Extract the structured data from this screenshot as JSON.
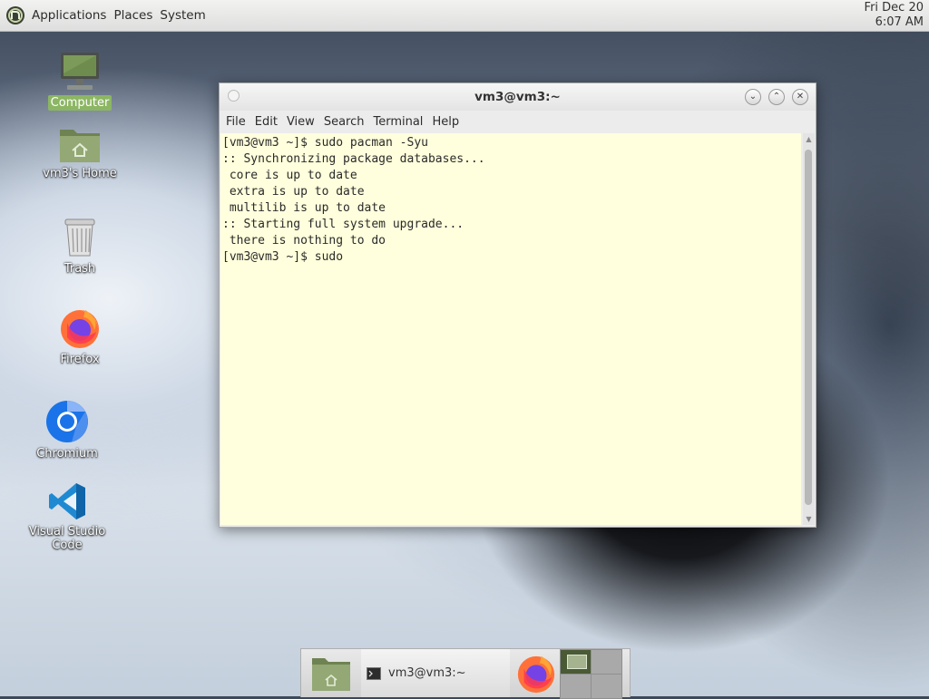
{
  "top_panel": {
    "menus": [
      "Applications",
      "Places",
      "System"
    ],
    "clock": {
      "date": "Fri Dec 20",
      "time": "6:07 AM"
    }
  },
  "desktop_icons": [
    {
      "label": "Computer",
      "icon": "computer-icon",
      "selected": true
    },
    {
      "label": "vm3's Home",
      "icon": "home-folder-icon"
    },
    {
      "label": "Trash",
      "icon": "trash-icon"
    },
    {
      "label": "Firefox",
      "icon": "firefox-icon"
    },
    {
      "label": "Chromium",
      "icon": "chromium-icon"
    },
    {
      "label": "Visual Studio Code",
      "icon": "vscode-icon"
    }
  ],
  "terminal_window": {
    "title": "vm3@vm3:~",
    "menus": [
      "File",
      "Edit",
      "View",
      "Search",
      "Terminal",
      "Help"
    ],
    "lines": [
      "[vm3@vm3 ~]$ sudo pacman -Syu",
      ":: Synchronizing package databases...",
      " core is up to date",
      " extra is up to date",
      " multilib is up to date",
      ":: Starting full system upgrade...",
      " there is nothing to do",
      "[vm3@vm3 ~]$ sudo"
    ],
    "background": "#ffffdd"
  },
  "bottom_panel": {
    "task_label": "vm3@vm3:~"
  },
  "colors": {
    "selection_green": "#8cb663",
    "accent": "#4a5a34"
  }
}
